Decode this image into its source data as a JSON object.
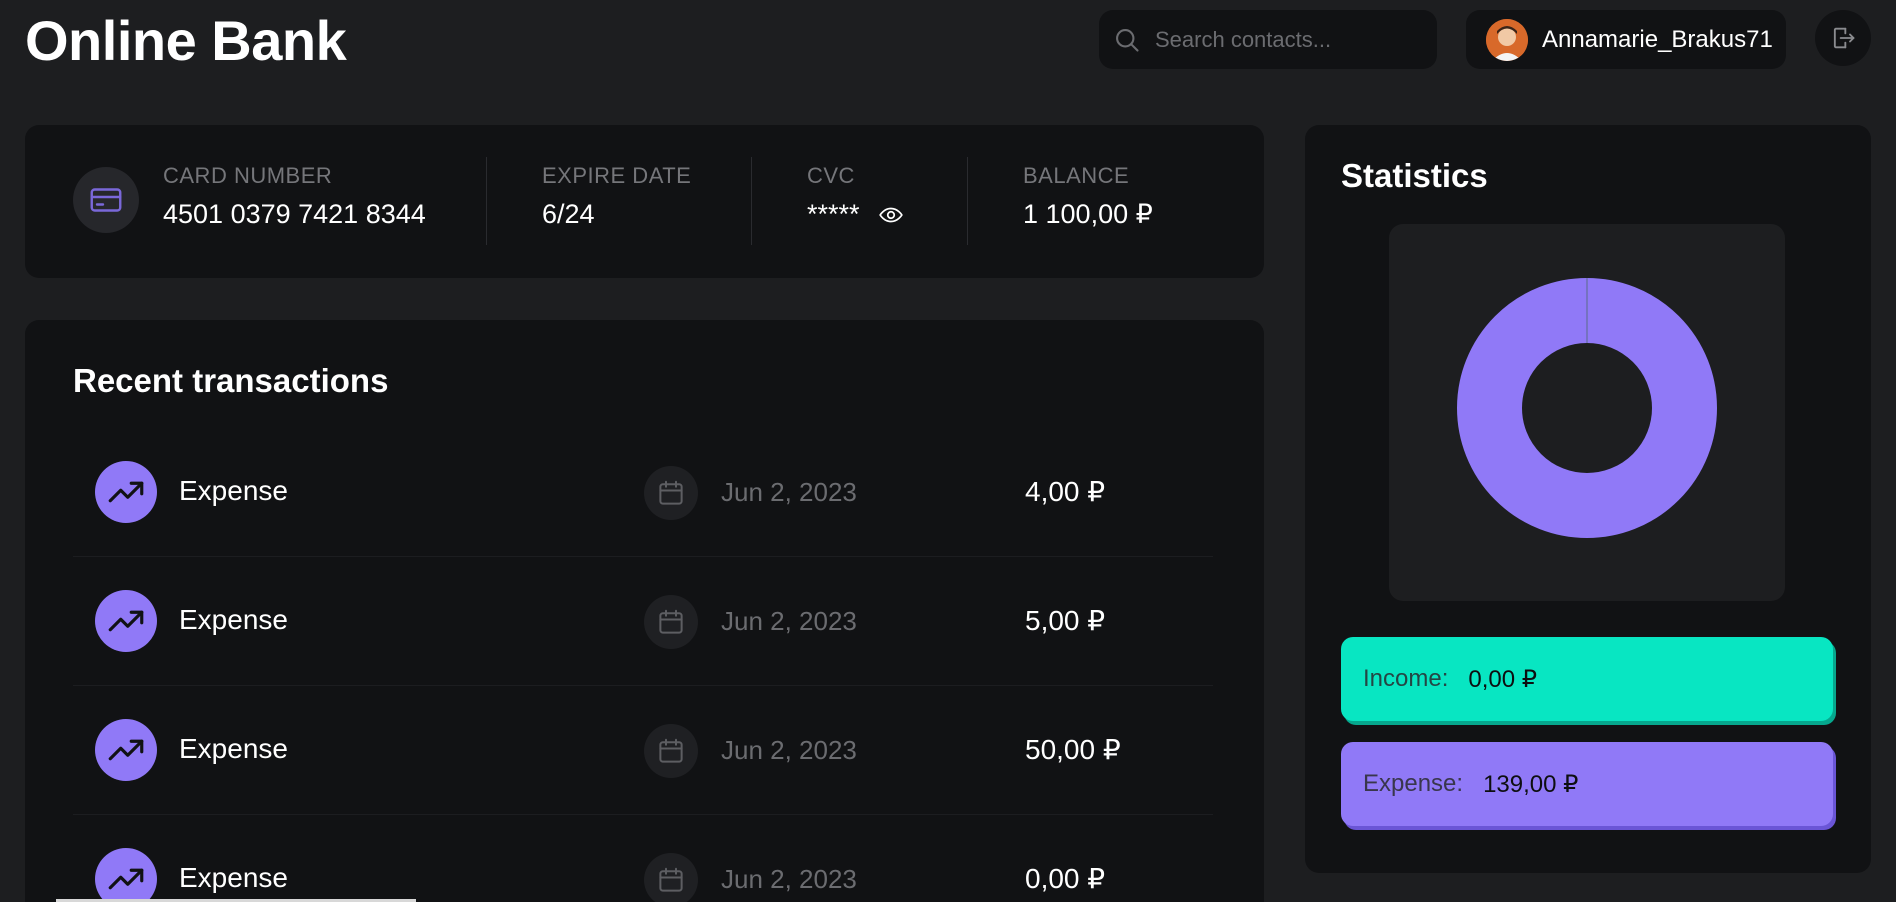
{
  "app": {
    "title": "Online Bank"
  },
  "header": {
    "search_placeholder": "Search contacts...",
    "user_name": "Annamarie_Brakus71"
  },
  "card": {
    "number_label": "CARD NUMBER",
    "number": "4501 0379 7421 8344",
    "expire_label": "EXPIRE DATE",
    "expire": "6/24",
    "cvc_label": "CVC",
    "cvc": "*****",
    "balance_label": "BALANCE",
    "balance": "1 100,00 ₽"
  },
  "transactions": {
    "title": "Recent transactions",
    "items": [
      {
        "type": "Expense",
        "date": "Jun 2, 2023",
        "amount": "4,00 ₽"
      },
      {
        "type": "Expense",
        "date": "Jun 2, 2023",
        "amount": "5,00 ₽"
      },
      {
        "type": "Expense",
        "date": "Jun 2, 2023",
        "amount": "50,00 ₽"
      },
      {
        "type": "Expense",
        "date": "Jun 2, 2023",
        "amount": "0,00 ₽"
      }
    ]
  },
  "statistics": {
    "title": "Statistics",
    "income_label": "Income:",
    "income_value": "0,00 ₽",
    "expense_label": "Expense:",
    "expense_value": "139,00 ₽",
    "income_color": "#08e6c2",
    "expense_color": "#9079f7"
  }
}
